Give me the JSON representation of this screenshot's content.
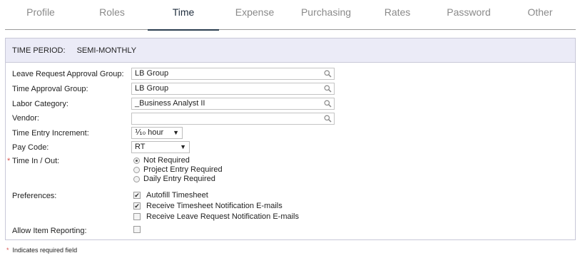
{
  "tabs": [
    {
      "label": "Profile"
    },
    {
      "label": "Roles"
    },
    {
      "label": "Time",
      "active": true
    },
    {
      "label": "Expense"
    },
    {
      "label": "Purchasing"
    },
    {
      "label": "Rates"
    },
    {
      "label": "Password"
    },
    {
      "label": "Other"
    }
  ],
  "time_period": {
    "label": "TIME PERIOD:",
    "value": "SEMI-MONTHLY"
  },
  "form": {
    "leave_group": {
      "label": "Leave Request Approval Group:",
      "value": "LB Group"
    },
    "time_group": {
      "label": "Time Approval Group:",
      "value": "LB Group"
    },
    "labor_category": {
      "label": "Labor Category:",
      "value": "_Business Analyst II"
    },
    "vendor": {
      "label": "Vendor:",
      "value": ""
    },
    "time_entry_increment": {
      "label": "Time Entry Increment:",
      "value": "⅒ hour",
      "arrow": "▼"
    },
    "pay_code": {
      "label": "Pay Code:",
      "value": "RT",
      "arrow": "▼"
    },
    "time_in_out": {
      "required_marker": "*",
      "label": "Time In / Out:",
      "options": [
        "Not Required",
        "Project Entry Required",
        "Daily Entry Required"
      ],
      "selected": "Not Required"
    },
    "preferences": {
      "label": "Preferences:",
      "options": [
        {
          "label": "Autofill Timesheet",
          "checked": true
        },
        {
          "label": "Receive Timesheet Notification E-mails",
          "checked": true
        },
        {
          "label": "Receive Leave Request Notification E-mails",
          "checked": false
        }
      ]
    },
    "allow_item_reporting": {
      "label": "Allow Item Reporting:",
      "checked": false
    }
  },
  "footnote": {
    "star": "*",
    "text": "Indicates required field"
  },
  "icons": {
    "lookup": "magnifier-icon",
    "check_mark": "✔"
  }
}
